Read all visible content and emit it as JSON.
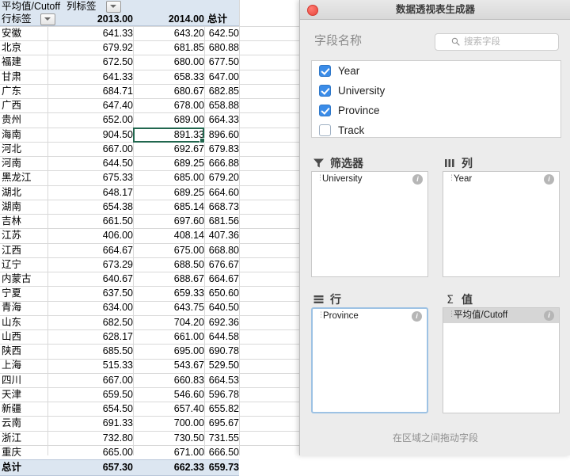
{
  "sheet": {
    "pivot": {
      "value_field_label": "平均值/Cutoff",
      "column_labels_header": "列标签",
      "row_labels_header": "行标签",
      "columns": [
        "2013.00",
        "2014.00",
        "总计"
      ],
      "grand_total_label": "总计",
      "grand_total_values": [
        "657.30",
        "662.33",
        "659.73"
      ],
      "rows": [
        {
          "name": "安徽",
          "v": [
            "641.33",
            "643.20",
            "642.50"
          ]
        },
        {
          "name": "北京",
          "v": [
            "679.92",
            "681.85",
            "680.88"
          ]
        },
        {
          "name": "福建",
          "v": [
            "672.50",
            "680.00",
            "677.50"
          ]
        },
        {
          "name": "甘肃",
          "v": [
            "641.33",
            "658.33",
            "647.00"
          ]
        },
        {
          "name": "广东",
          "v": [
            "684.71",
            "680.67",
            "682.85"
          ]
        },
        {
          "name": "广西",
          "v": [
            "647.40",
            "678.00",
            "658.88"
          ]
        },
        {
          "name": "贵州",
          "v": [
            "652.00",
            "689.00",
            "664.33"
          ]
        },
        {
          "name": "海南",
          "v": [
            "904.50",
            "891.33",
            "896.60"
          ]
        },
        {
          "name": "河北",
          "v": [
            "667.00",
            "692.67",
            "679.83"
          ]
        },
        {
          "name": "河南",
          "v": [
            "644.50",
            "689.25",
            "666.88"
          ]
        },
        {
          "name": "黑龙江",
          "v": [
            "675.33",
            "685.00",
            "679.20"
          ]
        },
        {
          "name": "湖北",
          "v": [
            "648.17",
            "689.25",
            "664.60"
          ]
        },
        {
          "name": "湖南",
          "v": [
            "654.38",
            "685.14",
            "668.73"
          ]
        },
        {
          "name": "吉林",
          "v": [
            "661.50",
            "697.60",
            "681.56"
          ]
        },
        {
          "name": "江苏",
          "v": [
            "406.00",
            "408.14",
            "407.36"
          ]
        },
        {
          "name": "江西",
          "v": [
            "664.67",
            "675.00",
            "668.80"
          ]
        },
        {
          "name": "辽宁",
          "v": [
            "673.29",
            "688.50",
            "676.67"
          ]
        },
        {
          "name": "内蒙古",
          "v": [
            "640.67",
            "688.67",
            "664.67"
          ]
        },
        {
          "name": "宁夏",
          "v": [
            "637.50",
            "659.33",
            "650.60"
          ]
        },
        {
          "name": "青海",
          "v": [
            "634.00",
            "643.75",
            "640.50"
          ]
        },
        {
          "name": "山东",
          "v": [
            "682.50",
            "704.20",
            "692.36"
          ]
        },
        {
          "name": "山西",
          "v": [
            "628.17",
            "661.00",
            "644.58"
          ]
        },
        {
          "name": "陕西",
          "v": [
            "685.50",
            "695.00",
            "690.78"
          ]
        },
        {
          "name": "上海",
          "v": [
            "515.33",
            "543.67",
            "529.50"
          ]
        },
        {
          "name": "四川",
          "v": [
            "667.00",
            "660.83",
            "664.53"
          ]
        },
        {
          "name": "天津",
          "v": [
            "659.50",
            "546.60",
            "596.78"
          ]
        },
        {
          "name": "新疆",
          "v": [
            "654.50",
            "657.40",
            "655.82"
          ]
        },
        {
          "name": "云南",
          "v": [
            "691.33",
            "700.00",
            "695.67"
          ]
        },
        {
          "name": "浙江",
          "v": [
            "732.80",
            "730.50",
            "731.55"
          ]
        },
        {
          "name": "重庆",
          "v": [
            "665.00",
            "671.00",
            "666.50"
          ]
        }
      ],
      "selected_cell_value": "891.33"
    }
  },
  "dialog": {
    "title": "数据透视表生成器",
    "field_section_label": "字段名称",
    "search_placeholder": "搜索字段",
    "fields": [
      {
        "label": "Year",
        "checked": true
      },
      {
        "label": "University",
        "checked": true
      },
      {
        "label": "Province",
        "checked": true
      },
      {
        "label": "Track",
        "checked": false
      }
    ],
    "zones": {
      "filters": {
        "label": "筛选器",
        "items": [
          "University"
        ]
      },
      "columns": {
        "label": "列",
        "items": [
          "Year"
        ]
      },
      "rows": {
        "label": "行",
        "items": [
          "Province"
        ]
      },
      "values": {
        "label": "值",
        "items": [
          "平均值/Cutoff"
        ]
      }
    },
    "hint": "在区域之间拖动字段"
  },
  "colors": {
    "header_fill": "#dce6f1",
    "selection_border": "#21674f",
    "checkbox_on": "#3b8ce8",
    "close_button": "#e8463c"
  }
}
